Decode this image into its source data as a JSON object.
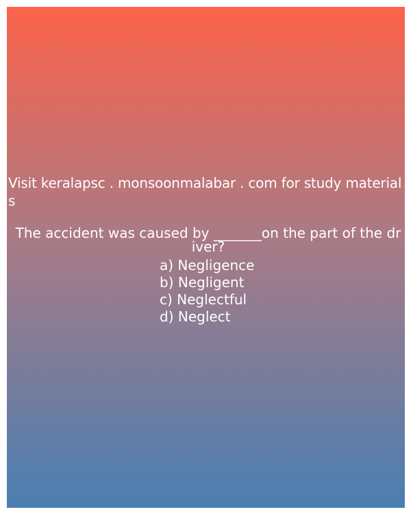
{
  "card": {
    "colors": {
      "gradient_top": "#fd634a",
      "gradient_mid": "#ab7a84",
      "gradient_bottom": "#4a7fb2",
      "text": "#ffffff"
    }
  },
  "site_line": "Visit keralapsc . monsoonmalabar . com for study materials",
  "question": {
    "text": "The accident was caused by _______on the part of the driver?",
    "options": [
      "a) Negligence",
      "b) Negligent",
      "c) Neglectful",
      "d) Neglect"
    ]
  }
}
